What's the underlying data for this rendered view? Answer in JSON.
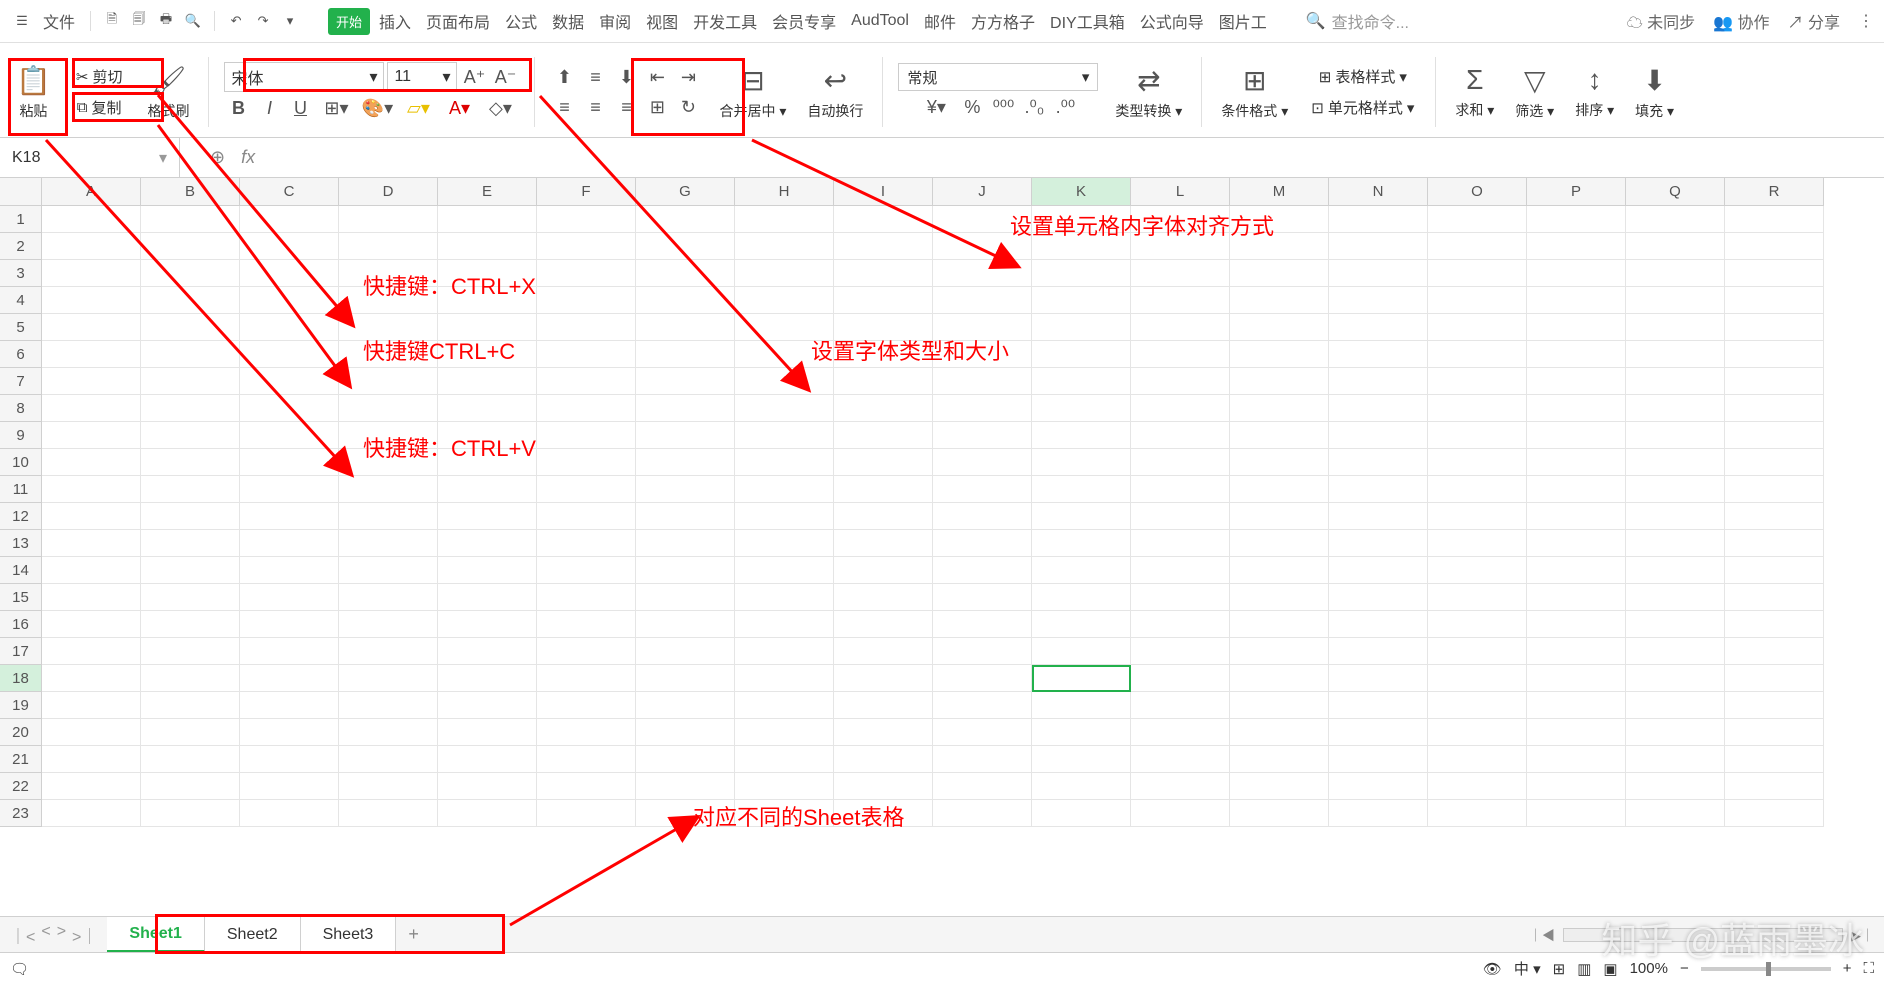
{
  "menu": {
    "file": "文件",
    "tabs": [
      "开始",
      "插入",
      "页面布局",
      "公式",
      "数据",
      "审阅",
      "视图",
      "开发工具",
      "会员专享",
      "AudTool",
      "邮件",
      "方方格子",
      "DIY工具箱",
      "公式向导",
      "图片工"
    ],
    "search_placeholder": "查找命令...",
    "sync": "未同步",
    "collab": "协作",
    "share": "分享"
  },
  "ribbon": {
    "paste": "粘贴",
    "cut": "剪切",
    "copy": "复制",
    "format_painter": "格式刷",
    "font": "宋体",
    "size": "11",
    "merge": "合并居中",
    "wrap": "自动换行",
    "format": "常规",
    "type_convert": "类型转换",
    "cond_format": "条件格式",
    "table_style": "表格样式",
    "cell_style": "单元格样式",
    "sum": "求和",
    "filter": "筛选",
    "sort": "排序",
    "fill": "填充"
  },
  "name_box": "K18",
  "columns": [
    "A",
    "B",
    "C",
    "D",
    "E",
    "F",
    "G",
    "H",
    "I",
    "J",
    "K",
    "L",
    "M",
    "N",
    "O",
    "P",
    "Q",
    "R"
  ],
  "rows": [
    "1",
    "2",
    "3",
    "4",
    "5",
    "6",
    "7",
    "8",
    "9",
    "10",
    "11",
    "12",
    "13",
    "14",
    "15",
    "16",
    "17",
    "18",
    "19",
    "20",
    "21",
    "22",
    "23"
  ],
  "active_col": "K",
  "active_row": "18",
  "annotations": {
    "a1": "快捷键：CTRL+X",
    "a2": "快捷键CTRL+C",
    "a3": "快捷键：CTRL+V",
    "a4": "设置单元格内字体对齐方式",
    "a5": "设置字体类型和大小",
    "a6": "对应不同的Sheet表格"
  },
  "tabs": [
    "Sheet1",
    "Sheet2",
    "Sheet3"
  ],
  "zoom": "100%",
  "watermark": "知乎 @蓝雨墨冰"
}
